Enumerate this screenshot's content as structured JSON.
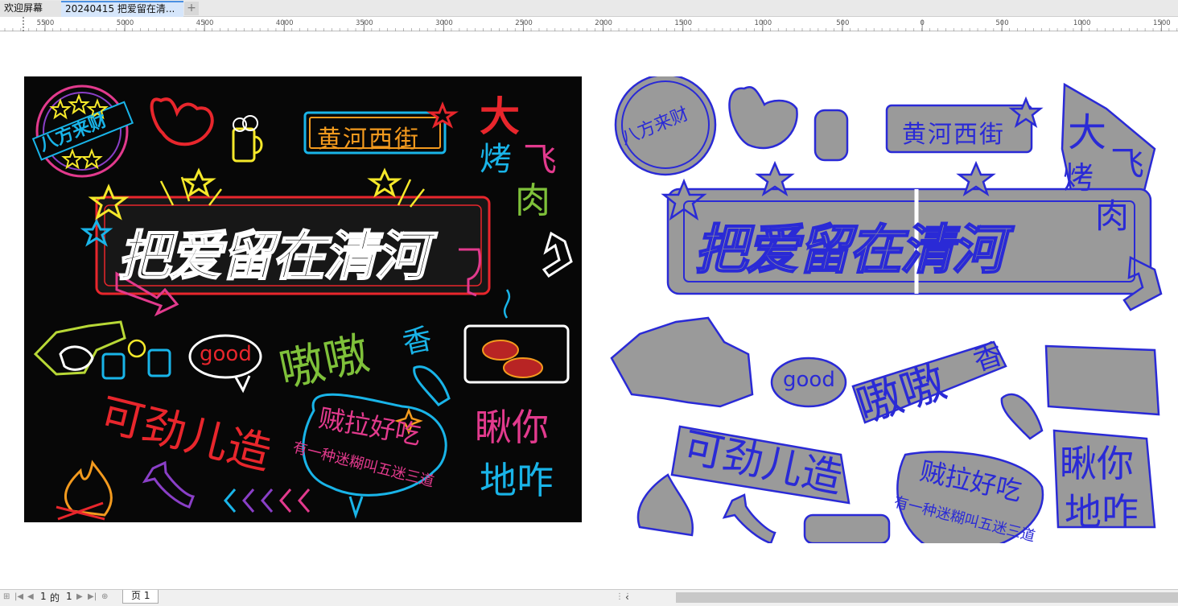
{
  "tabs": [
    {
      "label": "欢迎屏幕"
    },
    {
      "label": "20240415 把爱留在清..."
    }
  ],
  "tab_add_label": "+",
  "ruler": {
    "labels": [
      "5500",
      "5000",
      "4500",
      "4000",
      "3500",
      "3000",
      "2500",
      "2000",
      "1500",
      "1000",
      "500",
      "0",
      "500",
      "1000",
      "1500"
    ]
  },
  "artwork": {
    "badge_text": "八方来财",
    "sign_text": "黄河西街",
    "side_text": [
      "大",
      "飞",
      "烤",
      "肉"
    ],
    "main_title": "把爱留在清河",
    "good_text": "good",
    "neneng_text": "嗷嗷",
    "xiang_text": "香",
    "kejin_text": "可劲儿造",
    "zeila_text": "贼拉好吃",
    "slogan_text": "有一种迷糊叫五迷三道",
    "chou_text": [
      "瞅你",
      "地咋"
    ],
    "colors": {
      "neon_cyan": "#19b4e8",
      "neon_pink": "#e23a8d",
      "neon_yellow": "#f5e82a",
      "neon_red": "#e8262c",
      "neon_green": "#7fc13a",
      "neon_orange": "#f39a1e",
      "neon_purple": "#8a3fc7",
      "cut_blue": "#2a2ad6",
      "cut_gray": "#9a9a9a"
    }
  },
  "status": {
    "page_current": "1",
    "page_of": "的",
    "page_total": "1",
    "page_tab_label": "页 1"
  }
}
